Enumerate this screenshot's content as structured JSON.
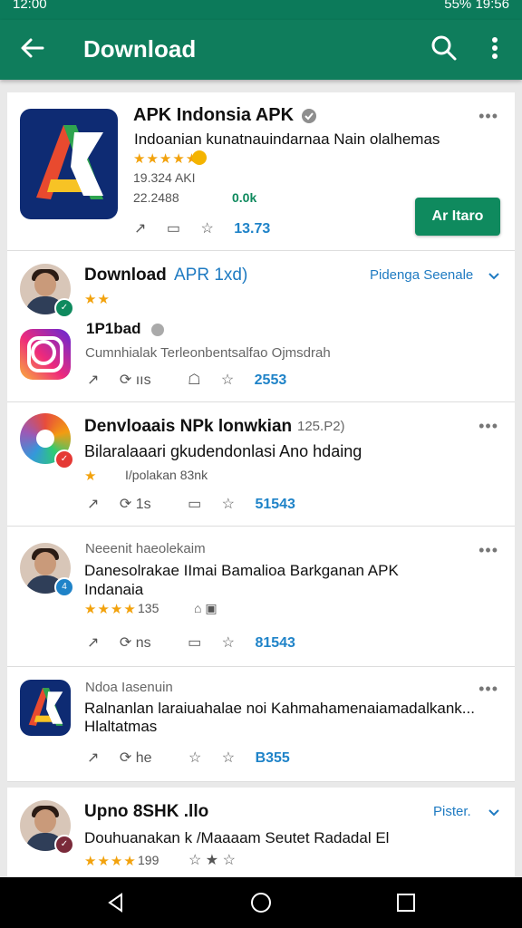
{
  "status_bar": {
    "time_left": "12:00",
    "battery": "55%",
    "time_right": "19:56"
  },
  "app_bar": {
    "title": "Download"
  },
  "feed": [
    {
      "title": "APK Indonsia APK",
      "subtitle": "Indoanian kunatnauindarnaa Nain olalhemas",
      "rating": "★★★★★",
      "size": "19.324 AKI",
      "stats": "22.2488",
      "downloads": "0.0k",
      "action_share": "1",
      "action_count": "13.73",
      "install_label": "Ar Itaro"
    },
    {
      "title": "Download",
      "title_link": "APR 1xd)",
      "right_label": "Pidenga Seenale",
      "rating": "★★",
      "sub_title": "1P1bad",
      "body": "Cumnhialak Terleonbentsalfao Ojmsdrah",
      "action_a": "ııs",
      "action_count": "2553"
    },
    {
      "title": "Denvloaais NPk lonwkian",
      "title_suffix": "125.P2)",
      "body": "Bilaralaaari gkudendonlasi Ano hdaing",
      "rating": "★",
      "meta": "I/polakan 83nk",
      "action_a": "1s",
      "action_count": "51543"
    },
    {
      "meta_top": "Neeenit haeolekaim",
      "body": "Danesolrakae IImai Bamalioa Barkganan APK Indanaia",
      "rating": "★★★★",
      "rating_count": "135",
      "action_a": "ns",
      "action_count": "81543"
    },
    {
      "meta_top": "Ndoa Iasenuin",
      "body": "Ralnanlan laraiuahalae noi Kahmahamenaiamadalkank...",
      "body2": "Hlaltatmas",
      "action_a": "he",
      "action_count": "B355"
    },
    {
      "title": "Upno 8SHK .llo",
      "right_label": "Pister.",
      "body": "Douhuanakan k /Maaaam Seutet Radadal El",
      "rating": "★★★★",
      "rating_count": "199"
    }
  ]
}
